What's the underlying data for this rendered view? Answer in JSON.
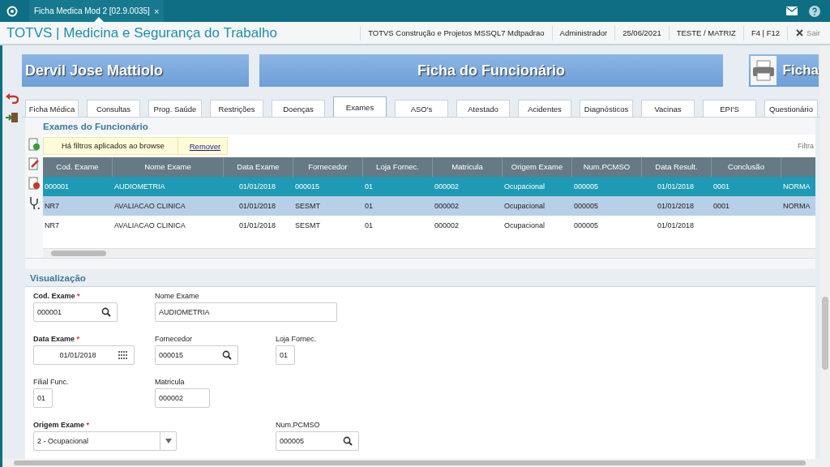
{
  "app_tab": {
    "label": "Ficha Medica Mod 2 [02.9.0035]",
    "close": "×"
  },
  "header": {
    "title": "TOTVS | Medicina e Segurança do Trabalho",
    "info": [
      "TOTVS Construção e Projetos MSSQL7 Mdtpadrao",
      "Administrador",
      "25/06/2021",
      "TESTE / MATRIZ",
      "F4 | F12"
    ],
    "exit": "Sair"
  },
  "banner": {
    "employee": "Dervil Jose Mattiolo",
    "title": "Ficha do Funcionário",
    "print_label": "Ficha"
  },
  "tabs": [
    {
      "label": "Ficha Médica",
      "selected": false
    },
    {
      "label": "Consultas",
      "selected": false
    },
    {
      "label": "Prog. Saúde",
      "selected": false
    },
    {
      "label": "Restrições",
      "selected": false
    },
    {
      "label": "Doenças",
      "selected": false
    },
    {
      "label": "Exames",
      "selected": true
    },
    {
      "label": "ASO's",
      "selected": false
    },
    {
      "label": "Atestado",
      "selected": false
    },
    {
      "label": "Acidentes",
      "selected": false
    },
    {
      "label": "Diagnósticos",
      "selected": false
    },
    {
      "label": "Vacinas",
      "selected": false
    },
    {
      "label": "EPI'S",
      "selected": false
    },
    {
      "label": "Questionário",
      "selected": false
    }
  ],
  "browse": {
    "title": "Exames do Funcionário",
    "filter_notice": "Há filtros aplicados ao browse",
    "remove_link": "Remover",
    "filter_label": "Filtra",
    "columns": [
      "Cod. Exame",
      "Nome Exame",
      "Data Exame",
      "Fornecedor",
      "Loja Fornec.",
      "Matricula",
      "Origem Exame",
      "Num.PCMSO",
      "Data Result.",
      "Conclusão"
    ],
    "rows": [
      {
        "selected": true,
        "highlighted": false,
        "cells": [
          "000001",
          "AUDIOMETRIA",
          "01/01/2018",
          "000015",
          "01",
          "000002",
          "Ocupacional",
          "000005",
          "01/01/2018",
          "0001",
          "NORMA"
        ]
      },
      {
        "selected": false,
        "highlighted": true,
        "cells": [
          "NR7",
          "AVALIACAO CLINICA",
          "01/01/2018",
          "SESMT",
          "01",
          "000002",
          "Ocupacional",
          "000005",
          "01/01/2018",
          "0001",
          "NORMA"
        ]
      },
      {
        "selected": false,
        "highlighted": false,
        "cells": [
          "NR7",
          "AVALIACAO CLINICA",
          "01/01/2018",
          "SESMT",
          "01",
          "000002",
          "Ocupacional",
          "000005",
          "01/01/2018",
          "",
          ""
        ]
      }
    ]
  },
  "details": {
    "title": "Visualização",
    "fields": [
      {
        "label": "Cod. Exame",
        "required_mark": "*",
        "kind": "lookup",
        "value": "000001"
      },
      {
        "label": "Nome Exame",
        "kind": "text",
        "value": "AUDIOMETRIA"
      },
      {
        "label": "Data Exame",
        "required_mark": "*",
        "kind": "date",
        "value": "01/01/2018"
      },
      {
        "label": "Fornecedor",
        "kind": "lookup",
        "value": "000015"
      },
      {
        "label": "Loja Fornec.",
        "kind": "text",
        "value": "01"
      },
      {
        "label": "Filial Func.",
        "kind": "text",
        "value": "01"
      },
      {
        "label": "Matricula",
        "kind": "text",
        "value": "000002"
      },
      {
        "label": "Origem Exame",
        "required_mark": "*",
        "kind": "select",
        "value": "2 - Ocupacional"
      },
      {
        "label": "Num.PCMSO",
        "kind": "lookup",
        "value": "000005"
      }
    ]
  }
}
